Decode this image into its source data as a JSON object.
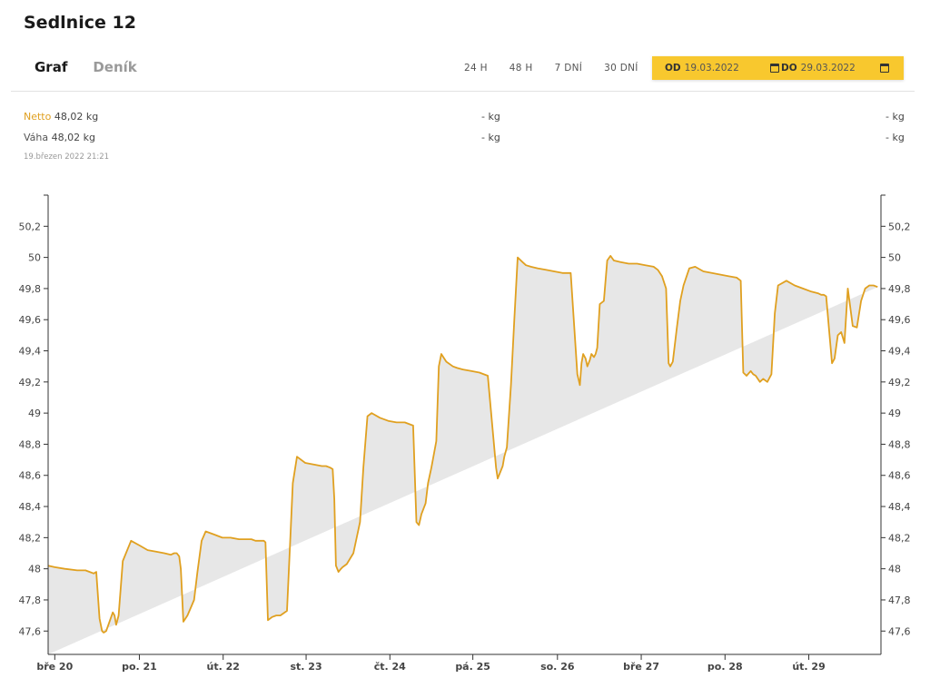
{
  "header": {
    "title": "Sedlnice 12"
  },
  "tabs": [
    {
      "label": "Graf"
    },
    {
      "label": "Deník"
    }
  ],
  "ranges": [
    {
      "label": "24 H"
    },
    {
      "label": "48 H"
    },
    {
      "label": "7 DNÍ"
    },
    {
      "label": "30 DNÍ"
    }
  ],
  "date_range": {
    "from_label": "OD",
    "from_value": "19.03.2022",
    "to_label": "DO",
    "to_value": "29.03.2022"
  },
  "readout": {
    "netto_label": "Netto",
    "netto_value": "48,02 kg",
    "vaha_label": "Váha",
    "vaha_value": "48,02 kg",
    "mid_netto": "- kg",
    "mid_vaha": "- kg",
    "right_netto": "- kg",
    "right_vaha": "- kg",
    "timestamp": "19.březen 2022 21:21"
  },
  "colors": {
    "accent": "#f8c82e",
    "line": "#e0a020",
    "fill": "#e7e7e7"
  },
  "chart_data": {
    "type": "area",
    "title": "",
    "xlabel": "",
    "ylabel": "",
    "ylim": [
      47.45,
      50.4
    ],
    "xlim": [
      0,
      10.04
    ],
    "grid": false,
    "yticks": [
      47.6,
      47.8,
      48,
      48.2,
      48.4,
      48.6,
      48.8,
      49,
      49.2,
      49.4,
      49.6,
      49.8,
      50,
      50.2
    ],
    "ytick_labels": [
      "47,6",
      "47,8",
      "48",
      "48,2",
      "48,4",
      "48,6",
      "48,8",
      "49",
      "49,2",
      "49,4",
      "49,6",
      "49,8",
      "50",
      "50,2"
    ],
    "xticks": [
      0.08,
      1.1,
      2.11,
      3.11,
      4.12,
      5.12,
      6.14,
      7.15,
      8.16,
      9.17
    ],
    "xtick_labels": [
      "bře 20",
      "po. 21",
      "út. 22",
      "st. 23",
      "čt. 24",
      "pá. 25",
      "so. 26",
      "bře 27",
      "po. 28",
      "út. 29"
    ],
    "x": [
      0,
      0.08,
      0.2,
      0.35,
      0.45,
      0.5,
      0.55,
      0.58,
      0.62,
      0.65,
      0.67,
      0.7,
      0.78,
      0.8,
      0.82,
      0.85,
      0.9,
      1.0,
      1.1,
      1.2,
      1.3,
      1.4,
      1.48,
      1.52,
      1.55,
      1.58,
      1.6,
      1.63,
      1.68,
      1.72,
      1.76,
      1.8,
      1.85,
      1.9,
      2.0,
      2.1,
      2.2,
      2.3,
      2.4,
      2.45,
      2.5,
      2.55,
      2.6,
      2.62,
      2.65,
      2.7,
      2.75,
      2.8,
      2.88,
      2.92,
      2.95,
      3.0,
      3.1,
      3.2,
      3.3,
      3.35,
      3.4,
      3.43,
      3.45,
      3.47,
      3.5,
      3.53,
      3.55,
      3.6,
      3.68,
      3.76,
      3.8,
      3.85,
      3.9,
      4.0,
      4.1,
      4.2,
      4.3,
      4.35,
      4.4,
      4.44,
      4.47,
      4.5,
      4.55,
      4.58,
      4.62,
      4.68,
      4.71,
      4.74,
      4.8,
      4.88,
      4.93,
      5.0,
      5.1,
      5.2,
      5.3,
      5.4,
      5.42,
      5.45,
      5.48,
      5.5,
      5.53,
      5.58,
      5.62,
      5.66,
      5.72,
      5.76,
      5.82,
      5.9,
      6.0,
      6.1,
      6.2,
      6.3,
      6.38,
      6.41,
      6.43,
      6.45,
      6.48,
      6.5,
      6.53,
      6.55,
      6.58,
      6.6,
      6.62,
      6.65,
      6.7,
      6.74,
      6.78,
      6.82,
      6.9,
      7.0,
      7.1,
      7.2,
      7.3,
      7.35,
      7.4,
      7.45,
      7.48,
      7.5,
      7.53,
      7.58,
      7.62,
      7.66,
      7.73,
      7.8,
      7.9,
      8.0,
      8.1,
      8.2,
      8.3,
      8.35,
      8.38,
      8.42,
      8.47,
      8.5,
      8.53,
      8.58,
      8.62,
      8.67,
      8.72,
      8.76,
      8.8,
      8.9,
      9.0,
      9.1,
      9.2,
      9.28,
      9.32,
      9.35,
      9.38,
      9.42,
      9.45,
      9.48,
      9.52,
      9.56,
      9.6,
      9.64,
      9.7,
      9.75,
      9.8,
      9.85,
      9.9,
      9.95,
      10.0,
      10.04
    ],
    "series": [
      {
        "values": [
          48.02,
          48.01,
          48.0,
          47.99,
          47.99,
          47.98,
          47.97,
          47.98,
          47.68,
          47.6,
          47.59,
          47.6,
          47.72,
          47.7,
          47.64,
          47.7,
          48.05,
          48.18,
          48.15,
          48.12,
          48.11,
          48.1,
          48.09,
          48.1,
          48.1,
          48.08,
          48.0,
          47.66,
          47.7,
          47.75,
          47.8,
          47.98,
          48.18,
          48.24,
          48.22,
          48.2,
          48.2,
          48.19,
          48.19,
          48.19,
          48.18,
          48.18,
          48.18,
          48.17,
          47.67,
          47.69,
          47.7,
          47.7,
          47.73,
          48.2,
          48.55,
          48.72,
          48.68,
          48.67,
          48.66,
          48.66,
          48.65,
          48.64,
          48.45,
          48.02,
          47.98,
          48.0,
          48.01,
          48.03,
          48.1,
          48.3,
          48.65,
          48.98,
          49.0,
          48.97,
          48.95,
          48.94,
          48.94,
          48.93,
          48.92,
          48.3,
          48.28,
          48.35,
          48.42,
          48.55,
          48.65,
          48.82,
          49.3,
          49.38,
          49.33,
          49.3,
          49.29,
          49.28,
          49.27,
          49.26,
          49.24,
          48.65,
          48.58,
          48.62,
          48.66,
          48.72,
          48.78,
          49.18,
          49.6,
          50.0,
          49.97,
          49.95,
          49.94,
          49.93,
          49.92,
          49.91,
          49.9,
          49.9,
          49.25,
          49.18,
          49.32,
          49.38,
          49.35,
          49.3,
          49.34,
          49.38,
          49.36,
          49.38,
          49.42,
          49.7,
          49.72,
          49.98,
          50.01,
          49.98,
          49.97,
          49.96,
          49.96,
          49.95,
          49.94,
          49.92,
          49.88,
          49.8,
          49.32,
          49.3,
          49.33,
          49.55,
          49.72,
          49.82,
          49.93,
          49.94,
          49.91,
          49.9,
          49.89,
          49.88,
          49.87,
          49.85,
          49.26,
          49.24,
          49.27,
          49.25,
          49.24,
          49.2,
          49.22,
          49.2,
          49.25,
          49.64,
          49.82,
          49.85,
          49.82,
          49.8,
          49.78,
          49.77,
          49.76,
          49.76,
          49.75,
          49.5,
          49.32,
          49.35,
          49.5,
          49.52,
          49.45,
          49.8,
          49.56,
          49.55,
          49.72,
          49.8,
          49.82,
          49.82,
          49.81
        ]
      }
    ]
  }
}
